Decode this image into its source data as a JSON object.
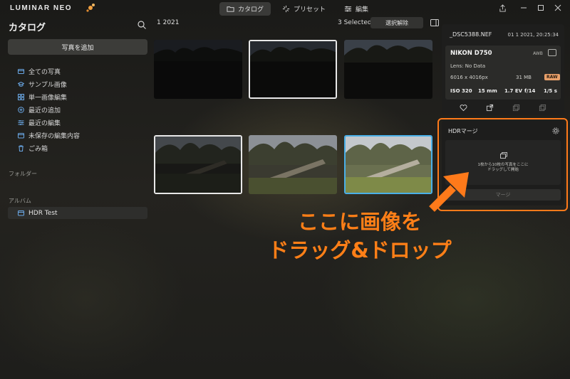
{
  "app": {
    "logo": "LUMINAR NEO",
    "tabs": [
      {
        "label": "カタログ",
        "icon": "folder-icon"
      },
      {
        "label": "プリセット",
        "icon": "sparkle-icon"
      },
      {
        "label": "編集",
        "icon": "sliders-icon"
      }
    ]
  },
  "sidebar": {
    "title": "カタログ",
    "add_button": "写真を追加",
    "items": [
      {
        "label": "全ての写真",
        "icon": "photos-icon"
      },
      {
        "label": "サンプル画像",
        "icon": "graduation-cap-icon"
      },
      {
        "label": "単一画像編集",
        "icon": "grid-icon"
      },
      {
        "label": "最近の追加",
        "icon": "plus-circle-icon"
      },
      {
        "label": "最近の編集",
        "icon": "sliders-icon"
      },
      {
        "label": "未保存の編集内容",
        "icon": "album-icon"
      },
      {
        "label": "ごみ箱",
        "icon": "trash-icon"
      }
    ],
    "folders_label": "フォルダー",
    "albums_label": "アルバム",
    "albums": [
      {
        "label": "HDR Test",
        "icon": "album-icon"
      }
    ]
  },
  "toolbar": {
    "date": "1 2021",
    "selected": "3 Selected",
    "deselect": "選択解除"
  },
  "info": {
    "filename": "_DSC5388.NEF",
    "datetime": "01 1 2021, 20:25:34",
    "camera": "NIKON D750",
    "awb": "AWB",
    "lens": "Lens: No Data",
    "dimensions": "6016 x 4016px",
    "size": "31 MB",
    "format": "RAW",
    "iso": "ISO 320",
    "focal": "15 mm",
    "ev": "1.7 EV",
    "aperture": "f/14",
    "shutter": "1/5 s"
  },
  "hdr": {
    "title": "HDRマージ",
    "drop_line1": "1枚から10枚の写真をここに",
    "drop_line2": "ドラッグして開始",
    "merge_button": "マージ"
  },
  "annotation": {
    "line1": "ここに画像を",
    "line2": "ドラッグ&ドロップ",
    "color": "#ff7f17"
  },
  "colors": {
    "accent_blue": "#4ab0e8",
    "icon_blue": "#6aa8e6",
    "raw_badge": "#e8a06a"
  }
}
